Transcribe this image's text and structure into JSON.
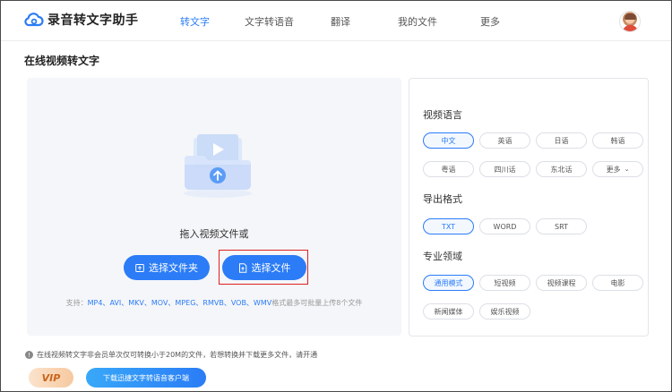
{
  "header": {
    "app_name": "录音转文字助手",
    "nav": [
      "转文字",
      "文字转语音",
      "翻译",
      "我的文件",
      "更多"
    ],
    "active_nav": "转文字"
  },
  "page_title": "在线视频转文字",
  "upload": {
    "drag_text": "拖入视频文件或",
    "folder_button": "选择文件夹",
    "file_button": "选择文件",
    "formats_prefix": "支持：",
    "formats": "MP4、AVI、MKV、MOV、MPEG、RMVB、VOB、WMV",
    "formats_suffix": "格式最多可批量上传8个文件"
  },
  "options": {
    "language_title": "视频语言",
    "languages": [
      "中文",
      "英语",
      "日语",
      "韩语",
      "粤语",
      "四川话",
      "东北话",
      "更多"
    ],
    "selected_language": "中文",
    "export_title": "导出格式",
    "export_formats": [
      "TXT",
      "WORD",
      "SRT"
    ],
    "selected_export": "TXT",
    "domain_title": "专业领域",
    "domains": [
      "通用模式",
      "短视频",
      "视频课程",
      "电影",
      "新闻媒体",
      "娱乐视频"
    ],
    "selected_domain": "通用模式"
  },
  "footer": {
    "notice": "在线视频转文字非会员单次仅可转换小于20M的文件，若想转换并下载更多文件，请开通",
    "vip_label": "VIP",
    "download_button": "下载迅捷文字转语音客户端"
  },
  "colors": {
    "accent": "#2b7cf6",
    "highlight_box": "#e02020"
  }
}
